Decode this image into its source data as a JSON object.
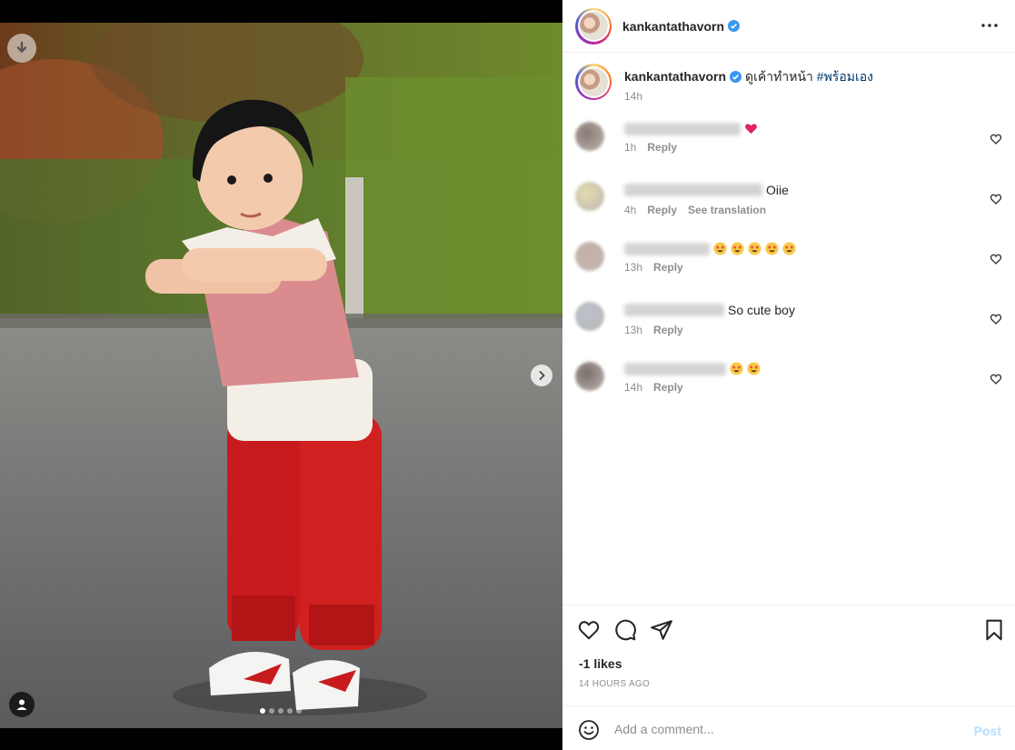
{
  "post": {
    "username": "kankantathavorn",
    "verified": true,
    "caption": "ดูเค้าทำหน้า",
    "hashtag": "#พร้อมเอง",
    "caption_time": "14h",
    "likes": "-1 likes",
    "time_ago": "14 HOURS AGO"
  },
  "carousel": {
    "slide_count": 5,
    "active_index": 0
  },
  "comments": [
    {
      "text": "",
      "emoji_count": 1,
      "emoji": "heart",
      "time": "1h",
      "reply": "Reply",
      "translation": ""
    },
    {
      "text": "Oiie",
      "emoji_count": 0,
      "emoji": "",
      "time": "4h",
      "reply": "Reply",
      "translation": "See translation"
    },
    {
      "text": "",
      "emoji_count": 5,
      "emoji": "star-struck",
      "time": "13h",
      "reply": "Reply",
      "translation": ""
    },
    {
      "text": "So cute boy",
      "emoji_count": 0,
      "emoji": "",
      "time": "13h",
      "reply": "Reply",
      "translation": ""
    },
    {
      "text": "",
      "emoji_count": 2,
      "emoji": "star-struck",
      "time": "14h",
      "reply": "Reply",
      "translation": ""
    }
  ],
  "add_comment": {
    "placeholder": "Add a comment...",
    "post_label": "Post"
  },
  "icons": {
    "download": "download-icon",
    "next": "chevron-right-icon",
    "tag": "user-tag-icon",
    "more": "more-options-icon",
    "like": "heart-icon",
    "comment": "comment-icon",
    "share": "share-icon",
    "save": "bookmark-icon",
    "emoji": "smile-icon"
  },
  "colors": {
    "verified": "#3897f0",
    "hashtag": "#00376b",
    "post_disabled": "#b2dffc",
    "meta_gray": "#8e8e8e"
  }
}
